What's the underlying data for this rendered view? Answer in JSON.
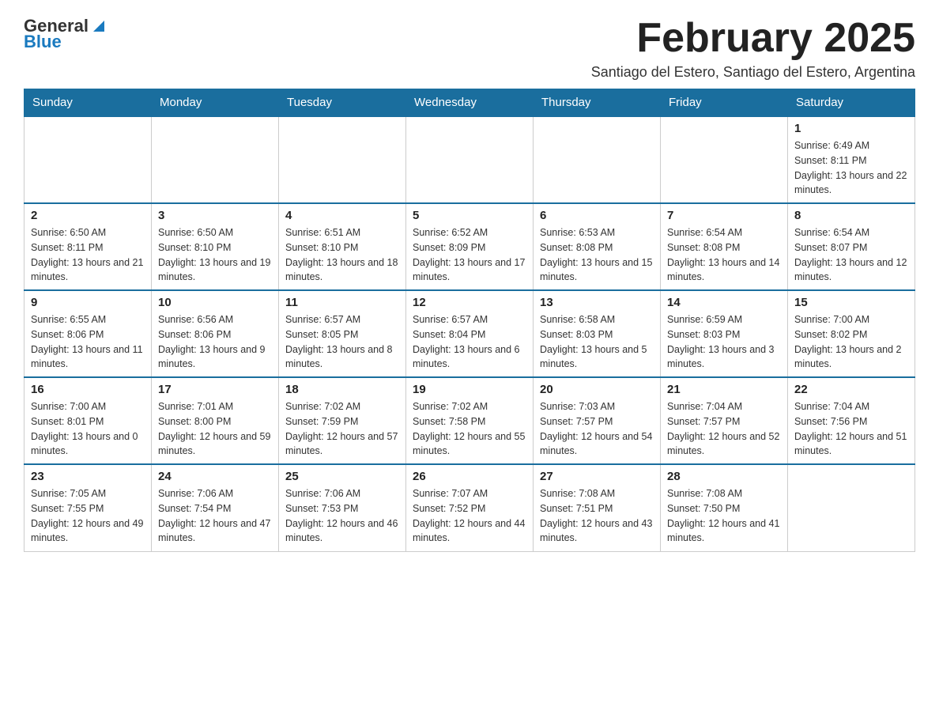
{
  "header": {
    "logo_general": "General",
    "logo_blue": "Blue",
    "title": "February 2025",
    "subtitle": "Santiago del Estero, Santiago del Estero, Argentina"
  },
  "weekdays": [
    "Sunday",
    "Monday",
    "Tuesday",
    "Wednesday",
    "Thursday",
    "Friday",
    "Saturday"
  ],
  "weeks": [
    [
      {
        "day": "",
        "info": ""
      },
      {
        "day": "",
        "info": ""
      },
      {
        "day": "",
        "info": ""
      },
      {
        "day": "",
        "info": ""
      },
      {
        "day": "",
        "info": ""
      },
      {
        "day": "",
        "info": ""
      },
      {
        "day": "1",
        "info": "Sunrise: 6:49 AM\nSunset: 8:11 PM\nDaylight: 13 hours and 22 minutes."
      }
    ],
    [
      {
        "day": "2",
        "info": "Sunrise: 6:50 AM\nSunset: 8:11 PM\nDaylight: 13 hours and 21 minutes."
      },
      {
        "day": "3",
        "info": "Sunrise: 6:50 AM\nSunset: 8:10 PM\nDaylight: 13 hours and 19 minutes."
      },
      {
        "day": "4",
        "info": "Sunrise: 6:51 AM\nSunset: 8:10 PM\nDaylight: 13 hours and 18 minutes."
      },
      {
        "day": "5",
        "info": "Sunrise: 6:52 AM\nSunset: 8:09 PM\nDaylight: 13 hours and 17 minutes."
      },
      {
        "day": "6",
        "info": "Sunrise: 6:53 AM\nSunset: 8:08 PM\nDaylight: 13 hours and 15 minutes."
      },
      {
        "day": "7",
        "info": "Sunrise: 6:54 AM\nSunset: 8:08 PM\nDaylight: 13 hours and 14 minutes."
      },
      {
        "day": "8",
        "info": "Sunrise: 6:54 AM\nSunset: 8:07 PM\nDaylight: 13 hours and 12 minutes."
      }
    ],
    [
      {
        "day": "9",
        "info": "Sunrise: 6:55 AM\nSunset: 8:06 PM\nDaylight: 13 hours and 11 minutes."
      },
      {
        "day": "10",
        "info": "Sunrise: 6:56 AM\nSunset: 8:06 PM\nDaylight: 13 hours and 9 minutes."
      },
      {
        "day": "11",
        "info": "Sunrise: 6:57 AM\nSunset: 8:05 PM\nDaylight: 13 hours and 8 minutes."
      },
      {
        "day": "12",
        "info": "Sunrise: 6:57 AM\nSunset: 8:04 PM\nDaylight: 13 hours and 6 minutes."
      },
      {
        "day": "13",
        "info": "Sunrise: 6:58 AM\nSunset: 8:03 PM\nDaylight: 13 hours and 5 minutes."
      },
      {
        "day": "14",
        "info": "Sunrise: 6:59 AM\nSunset: 8:03 PM\nDaylight: 13 hours and 3 minutes."
      },
      {
        "day": "15",
        "info": "Sunrise: 7:00 AM\nSunset: 8:02 PM\nDaylight: 13 hours and 2 minutes."
      }
    ],
    [
      {
        "day": "16",
        "info": "Sunrise: 7:00 AM\nSunset: 8:01 PM\nDaylight: 13 hours and 0 minutes."
      },
      {
        "day": "17",
        "info": "Sunrise: 7:01 AM\nSunset: 8:00 PM\nDaylight: 12 hours and 59 minutes."
      },
      {
        "day": "18",
        "info": "Sunrise: 7:02 AM\nSunset: 7:59 PM\nDaylight: 12 hours and 57 minutes."
      },
      {
        "day": "19",
        "info": "Sunrise: 7:02 AM\nSunset: 7:58 PM\nDaylight: 12 hours and 55 minutes."
      },
      {
        "day": "20",
        "info": "Sunrise: 7:03 AM\nSunset: 7:57 PM\nDaylight: 12 hours and 54 minutes."
      },
      {
        "day": "21",
        "info": "Sunrise: 7:04 AM\nSunset: 7:57 PM\nDaylight: 12 hours and 52 minutes."
      },
      {
        "day": "22",
        "info": "Sunrise: 7:04 AM\nSunset: 7:56 PM\nDaylight: 12 hours and 51 minutes."
      }
    ],
    [
      {
        "day": "23",
        "info": "Sunrise: 7:05 AM\nSunset: 7:55 PM\nDaylight: 12 hours and 49 minutes."
      },
      {
        "day": "24",
        "info": "Sunrise: 7:06 AM\nSunset: 7:54 PM\nDaylight: 12 hours and 47 minutes."
      },
      {
        "day": "25",
        "info": "Sunrise: 7:06 AM\nSunset: 7:53 PM\nDaylight: 12 hours and 46 minutes."
      },
      {
        "day": "26",
        "info": "Sunrise: 7:07 AM\nSunset: 7:52 PM\nDaylight: 12 hours and 44 minutes."
      },
      {
        "day": "27",
        "info": "Sunrise: 7:08 AM\nSunset: 7:51 PM\nDaylight: 12 hours and 43 minutes."
      },
      {
        "day": "28",
        "info": "Sunrise: 7:08 AM\nSunset: 7:50 PM\nDaylight: 12 hours and 41 minutes."
      },
      {
        "day": "",
        "info": ""
      }
    ]
  ]
}
